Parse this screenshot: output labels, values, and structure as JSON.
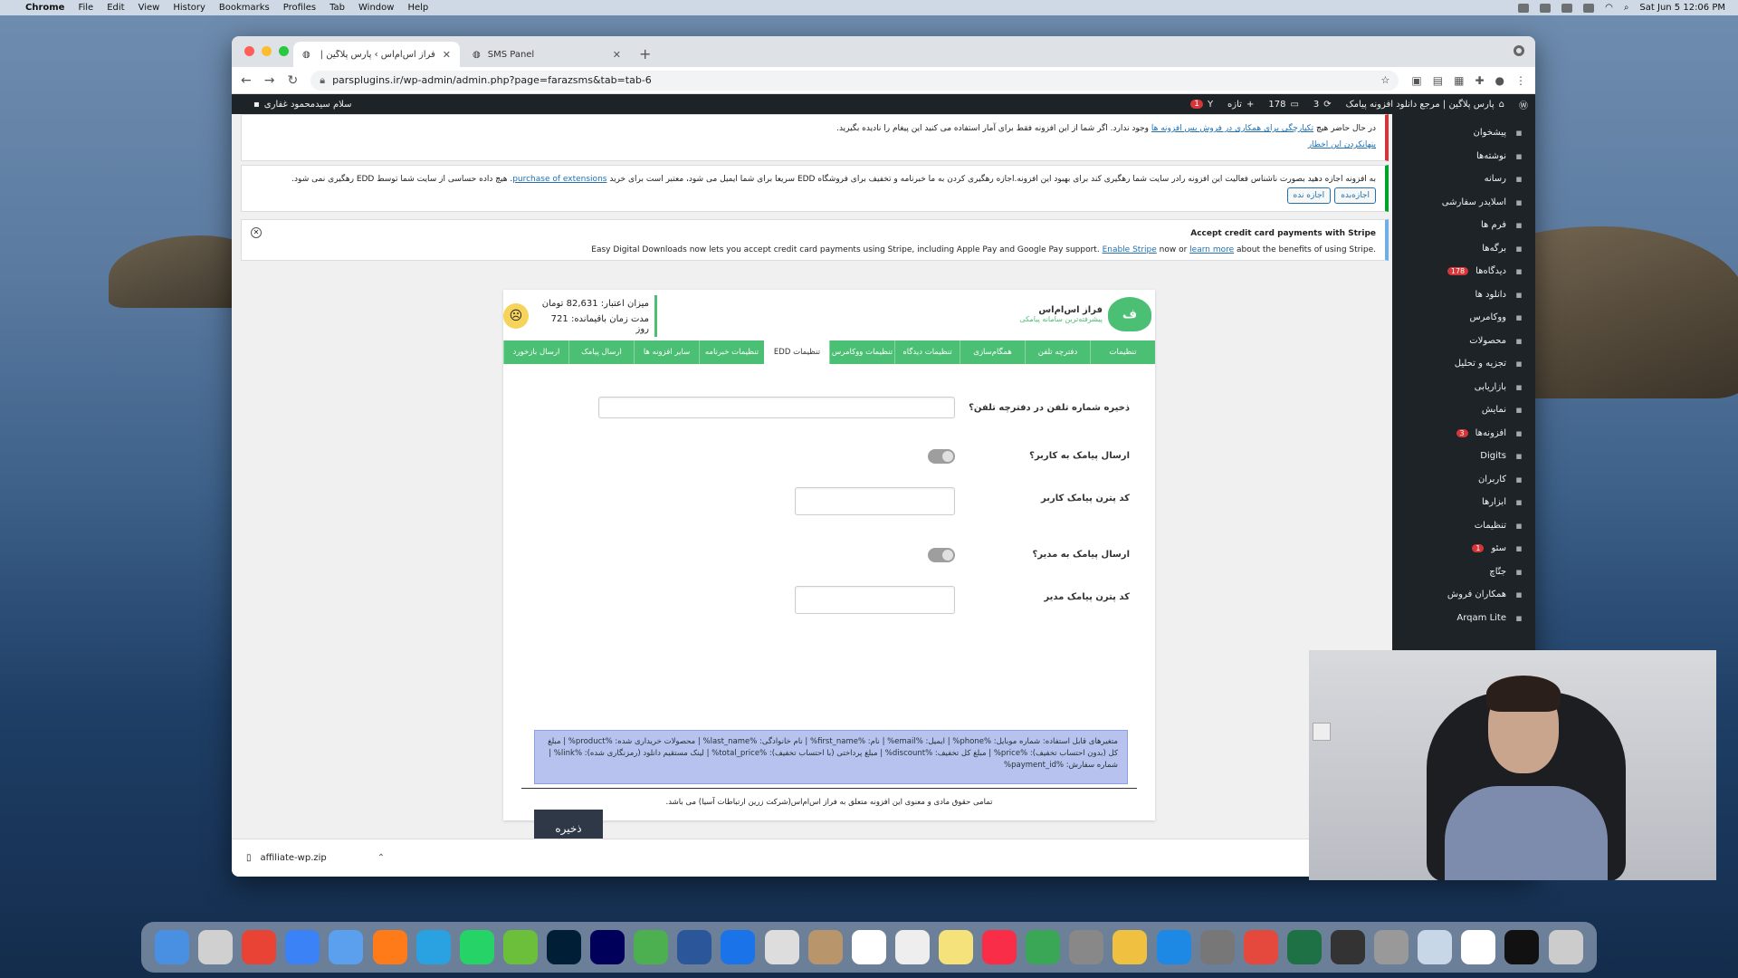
{
  "menubar": {
    "app": "Chrome",
    "items": [
      "File",
      "Edit",
      "View",
      "History",
      "Bookmarks",
      "Profiles",
      "Tab",
      "Window",
      "Help"
    ],
    "clock": "Sat Jun 5  12:06 PM"
  },
  "browser": {
    "tabs": [
      {
        "title": "فراز اس‌ام‌اس › پارس پلاگین | مرجع"
      },
      {
        "title": "SMS Panel"
      }
    ],
    "url": "parsplugins.ir/wp-admin/admin.php?page=farazsms&tab=tab-6"
  },
  "adminbar": {
    "site": "پارس پلاگین | مرجع دانلود افزونه پیامک",
    "updates": "1",
    "comments": "178",
    "pending": "3",
    "new": "تازه",
    "greeting": "سلام سیدمحمود غفاری"
  },
  "sidebar": {
    "items": [
      {
        "label": "پیشخوان",
        "icon": "dashboard-icon"
      },
      {
        "label": "نوشته‌ها",
        "icon": "pin-icon"
      },
      {
        "label": "رسانه",
        "icon": "media-icon"
      },
      {
        "label": "اسلایدر سفارشی",
        "icon": "slider-icon"
      },
      {
        "label": "فرم ها",
        "icon": "form-icon"
      },
      {
        "label": "برگه‌ها",
        "icon": "page-icon"
      },
      {
        "label": "دیدگاه‌ها",
        "icon": "comment-icon",
        "badge": "178"
      },
      {
        "label": "دانلود ها",
        "icon": "download-icon"
      },
      {
        "label": "ووکامرس",
        "icon": "woo-icon"
      },
      {
        "label": "محصولات",
        "icon": "product-icon"
      },
      {
        "label": "تجزیه و تحلیل",
        "icon": "chart-icon"
      },
      {
        "label": "بازاریابی",
        "icon": "megaphone-icon"
      },
      {
        "label": "نمایش",
        "icon": "brush-icon"
      },
      {
        "label": "افزونه‌ها",
        "icon": "plugin-icon",
        "badge": "3"
      },
      {
        "label": "Digits",
        "icon": "star-icon"
      },
      {
        "label": "کاربران",
        "icon": "user-icon"
      },
      {
        "label": "ابزارها",
        "icon": "wrench-icon"
      },
      {
        "label": "تنظیمات",
        "icon": "settings-icon"
      },
      {
        "label": "سئو",
        "icon": "yoast-icon",
        "badge": "1"
      },
      {
        "label": "جتّاچ",
        "icon": "jetpack-icon"
      },
      {
        "label": "همکاران فروش",
        "icon": "affiliate-icon"
      },
      {
        "label": "Arqam Lite",
        "icon": "heart-icon"
      }
    ]
  },
  "notices": {
    "n1_text": "در حال حاضر هیچ",
    "n1_link": "تکیارچگی برای همکاری در فروش بس افزونه ها",
    "n1_rest": "وجود ندارد. اگر شما از این افزونه فقط برای آمار استفاده می کنید این پیغام را نادیده بگیرید.",
    "n1_hide": "پنهانکردن این اخطار",
    "n2_text": "به افزونه اجازه دهید بصورت ناشناس فعالیت این افزونه رادر سایت شما رهگیری کند برای بهبود این افزونه.اجازه رهگیری کردن به ما خبرنامه و تخفیف برای فروشگاه EDD سریعا برای شما ایمیل می شود، معتبر است برای خرید",
    "n2_link": "purchase of extensions",
    "n2_rest": ". هیچ داده حساسی از سایت شما توسط EDD رهگیری نمی شود.",
    "n2_allow": "اجازه‌بده",
    "n2_deny": "اجازه نده",
    "n3_title": "Accept credit card payments with Stripe",
    "n3_text": "Easy Digital Downloads now lets you accept credit card payments using Stripe, including Apple Pay and Google Pay support.",
    "n3_link1": "Enable Stripe",
    "n3_mid": "now or",
    "n3_link2": "learn more",
    "n3_end": "about the benefits of using Stripe."
  },
  "panel": {
    "brand": "فراز اس‌ام‌اس",
    "brand_sub": "پیشرفته‌ترین سامانه پیامکی",
    "credit": "میزان اعتبار: 82,631 تومان",
    "remaining": "مدت زمان باقیمانده: 721 روز",
    "tabs": [
      "تنظیمات",
      "دفترچه تلفن",
      "همگام‌سازی",
      "تنظیمات دیدگاه",
      "تنظیمات ووکامرس",
      "تنظیمات EDD",
      "تنظیمات خبرنامه",
      "سایر افزونه ها",
      "ارسال پیامک",
      "ارسال بازخورد"
    ],
    "active_tab": "تنظیمات EDD",
    "label_phonebook": "ذخیره شماره تلفن در دفترچه تلفن؟",
    "label_user_sms": "ارسال پیامک به کاربر؟",
    "label_user_pattern": "کد پترن پیامک کاربر",
    "label_admin_sms": "ارسال پیامک به مدیر؟",
    "label_admin_pattern": "کد پترن پیامک مدیر",
    "vars_text": "متغیرهای قابل استفاده: شماره موبایل: %phone% | ایمیل: %email% | نام: %first_name% | نام خانوادگی: %last_name% | محصولات خریداری شده: %product% | مبلغ کل (بدون احتساب تخفیف): %price% | مبلغ کل تخفیف: %discount% | مبلغ پرداختی (با احتساب تخفیف): %total_price% | لینک مستقیم دانلود (رمزنگاری شده): %link% | شماره سفارش: %payment_id%",
    "save": "ذخیره",
    "footer": "تمامی حقوق مادی و معنوی این افزونه متعلق به فراز اس‌ام‌اس(شرکت زرین ارتباطات آسیا) می باشد."
  },
  "download": {
    "file": "affiliate-wp.zip"
  }
}
